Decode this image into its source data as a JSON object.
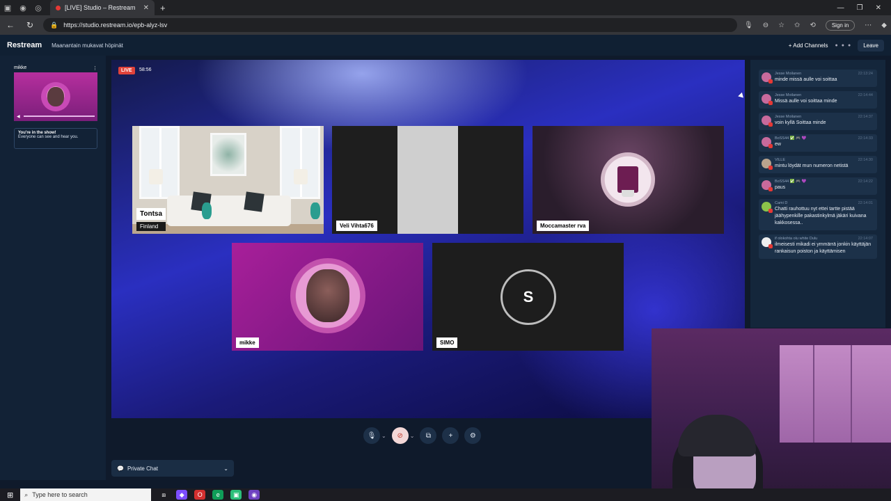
{
  "browser": {
    "tab_title": "[LIVE] Studio – Restream",
    "url": "https://studio.restream.io/epb-alyz-lsv",
    "sign_in": "Sign in"
  },
  "header": {
    "logo": "Restream",
    "stream_title": "Maanantain mukavat höpinät",
    "add_channels": "+ Add Channels",
    "leave": "Leave"
  },
  "self_view": {
    "name": "mikke",
    "in_show_title": "You're in the show!",
    "in_show_text": "Everyone can see and hear you."
  },
  "stage": {
    "live_badge": "LIVE",
    "timer": "58:56",
    "tiles": [
      {
        "name": "Tontsa",
        "sub": "Finland"
      },
      {
        "name": "Veli Vihta676"
      },
      {
        "name": "Moccamaster rva"
      },
      {
        "name": "mikke"
      },
      {
        "name": "SIMO",
        "initial": "S"
      }
    ]
  },
  "private_chat": {
    "label": "Private Chat"
  },
  "chat": [
    {
      "user": "Jesse Moilanen",
      "time": "22:13:24",
      "text": "minde missä aulle voi soittaa",
      "av": "pink"
    },
    {
      "user": "Jesse Moilanen",
      "time": "22:14:44",
      "text": "Missä aulle voi soittaa minde",
      "av": "pink"
    },
    {
      "user": "Jesse Moilanen",
      "time": "22:14:37",
      "text": "voin kyllä Soittaa minde",
      "av": "pink"
    },
    {
      "user": "BoSS44 ✅ 🎮 💜",
      "time": "22:14:33",
      "text": "ew",
      "av": "pink"
    },
    {
      "user": "VILLE",
      "time": "22:14:30",
      "text": "mintu löydät mun numeron netistä",
      "av": "grey"
    },
    {
      "user": "BoSS44 ✅ 🎮 💜",
      "time": "22:14:22",
      "text": "paus",
      "av": "pink"
    },
    {
      "user": "Cami D",
      "time": "22:14:01",
      "text": "Chatti rauhottuu nyt ettei tartte pistää jäähypenkille pakastinkylmä jäkäri kuivana kakkosessa..",
      "av": "green"
    },
    {
      "user": "if olokohta olu white Dulu",
      "time": "22:14:07",
      "text": "ilmeisesti mikadi ei ymmärrä jonkin käyttäjän rankaisun poiston ja käyttämisen",
      "av": "white"
    }
  ],
  "taskbar": {
    "search_placeholder": "Type here to search"
  },
  "colors": {
    "live": "#e0423a",
    "stage_accent": "#2a2fc0",
    "panel": "#122236"
  }
}
